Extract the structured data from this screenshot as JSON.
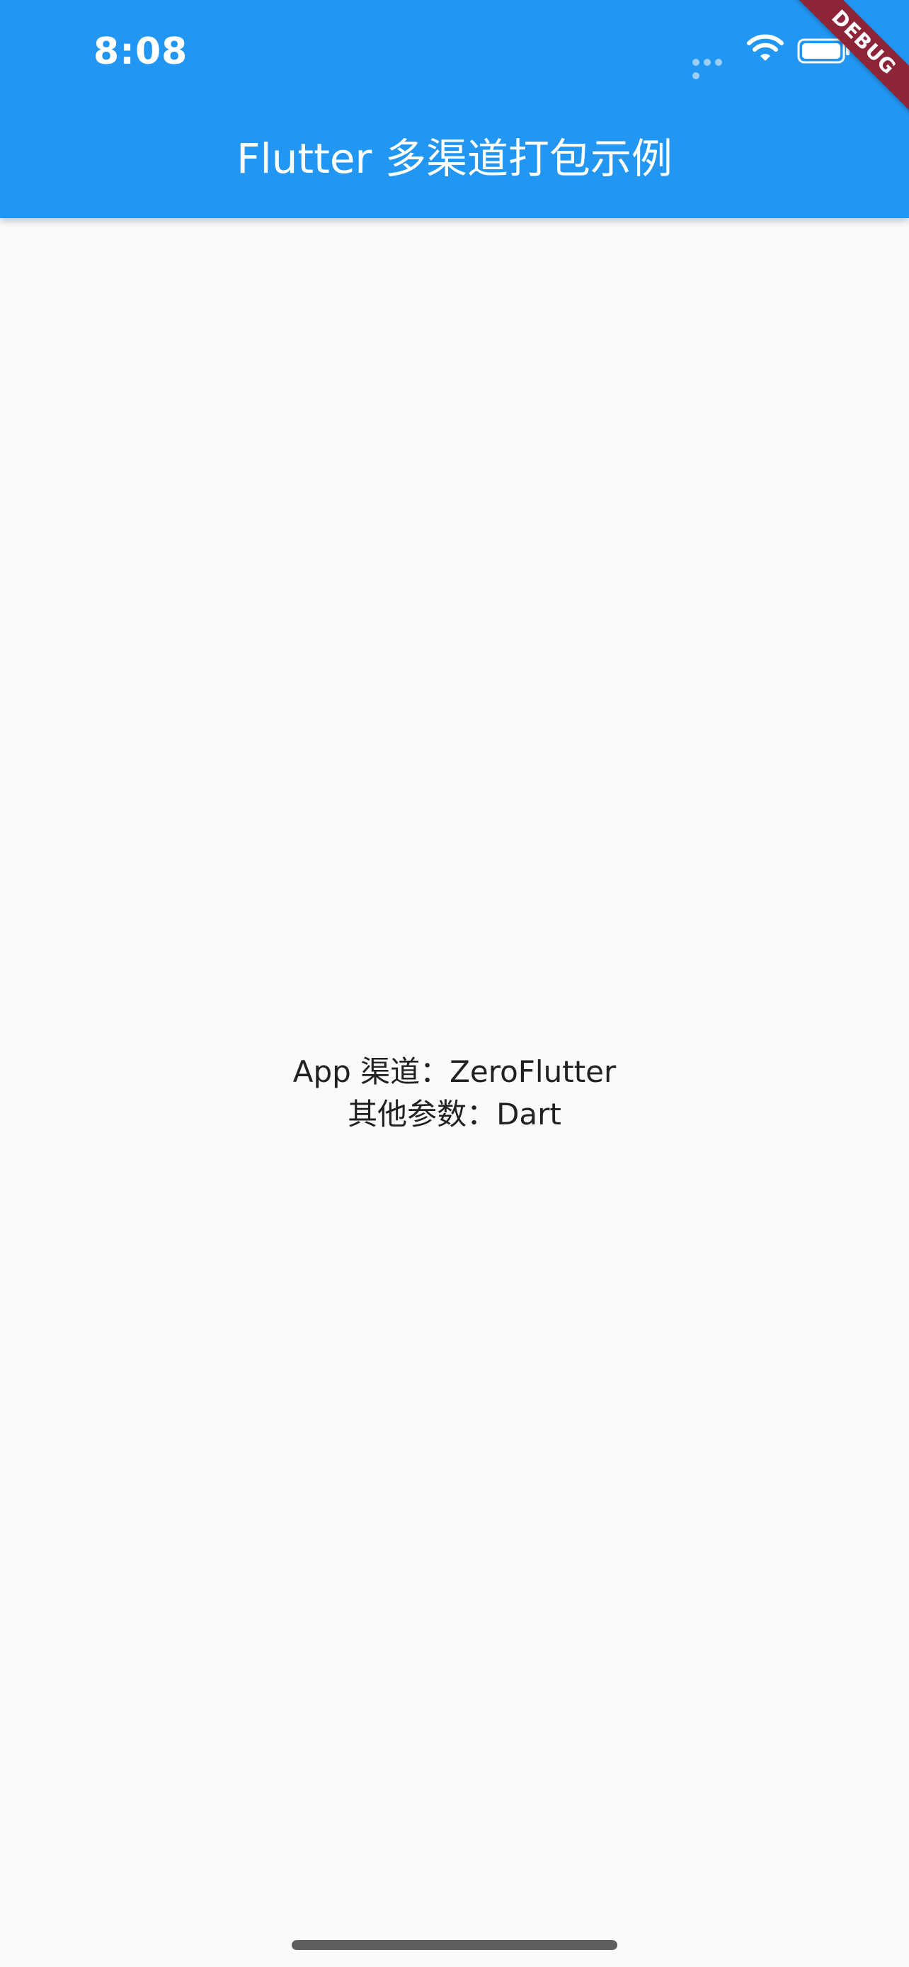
{
  "status_bar": {
    "time": "8:08",
    "wifi_icon": "wifi-icon",
    "battery_icon": "battery-icon",
    "signal_icon": "signal-dots-icon"
  },
  "app_bar": {
    "title": "Flutter 多渠道打包示例",
    "background": "#2196F3"
  },
  "debug_banner": {
    "label": "DEBUG",
    "color": "#8E2438"
  },
  "content": {
    "channel_line": "App 渠道：ZeroFlutter",
    "params_line": "其他参数：Dart"
  },
  "home_indicator": {
    "icon": "home-indicator"
  }
}
